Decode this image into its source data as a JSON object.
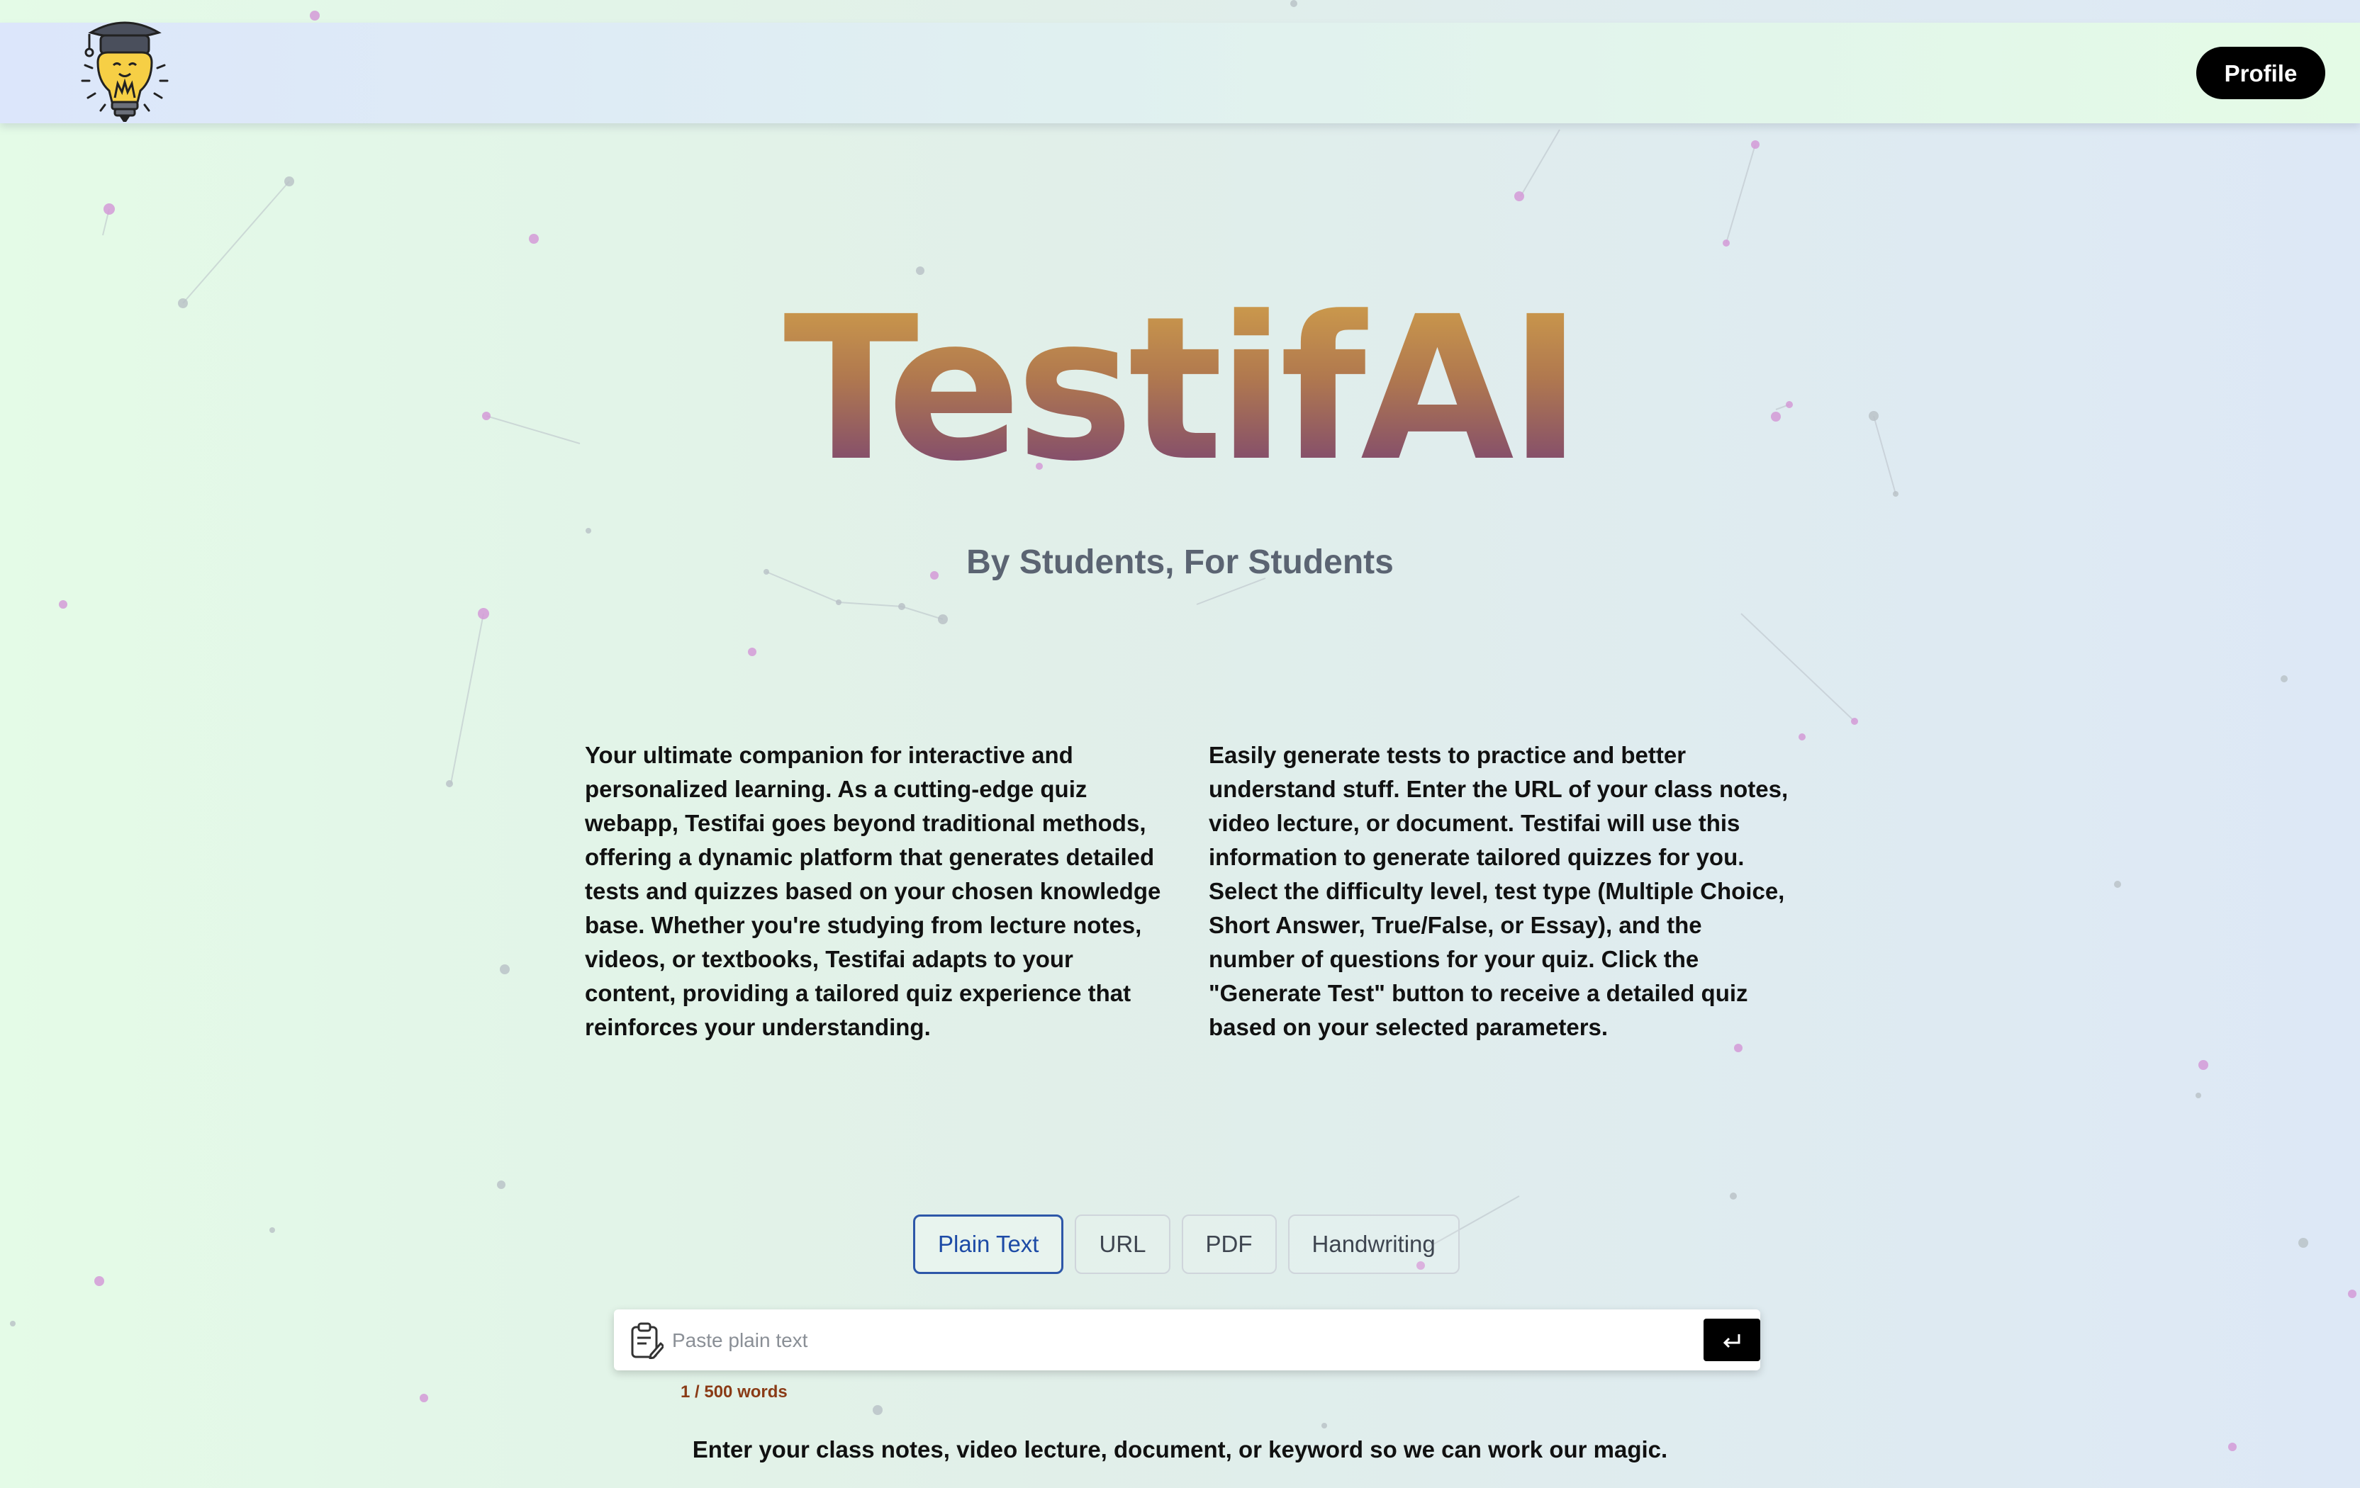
{
  "header": {
    "logo_icon": "graduate-lightbulb-icon",
    "profile_label": "Profile"
  },
  "hero": {
    "title": "TestifAI",
    "tagline": "By Students, For Students"
  },
  "descriptions": {
    "left": "Your ultimate companion for interactive and personalized learning. As a cutting-edge quiz webapp, Testifai goes beyond traditional methods, offering a dynamic platform that generates detailed tests and quizzes based on your chosen knowledge base. Whether you're studying from lecture notes, videos, or textbooks, Testifai adapts to your content, providing a tailored quiz experience that reinforces your understanding.",
    "right": "Easily generate tests to practice and better understand stuff. Enter the URL of your class notes, video lecture, or document. Testifai will use this information to generate tailored quizzes for you. Select the difficulty level, test type (Multiple Choice, Short Answer, True/False, or Essay), and the number of questions for your quiz. Click the \"Generate Test\" button to receive a detailed quiz based on your selected parameters."
  },
  "input_tabs": {
    "selected": "Plain Text",
    "items": [
      "Plain Text",
      "URL",
      "PDF",
      "Handwriting"
    ]
  },
  "input": {
    "placeholder": "Paste plain text",
    "value": "",
    "leading_icon": "clipboard-edit-icon",
    "submit_icon": "enter-return-icon",
    "word_count": "1 / 500 words"
  },
  "footer_hint": "Enter your class notes, video lecture, document, or keyword so we can work our magic.",
  "colors": {
    "title_gradient_top": "#d5a54a",
    "title_gradient_bottom": "#6f3a79",
    "active_tab": "#1d4ba6",
    "word_count": "#8a3b16",
    "profile_button": "#000000"
  }
}
